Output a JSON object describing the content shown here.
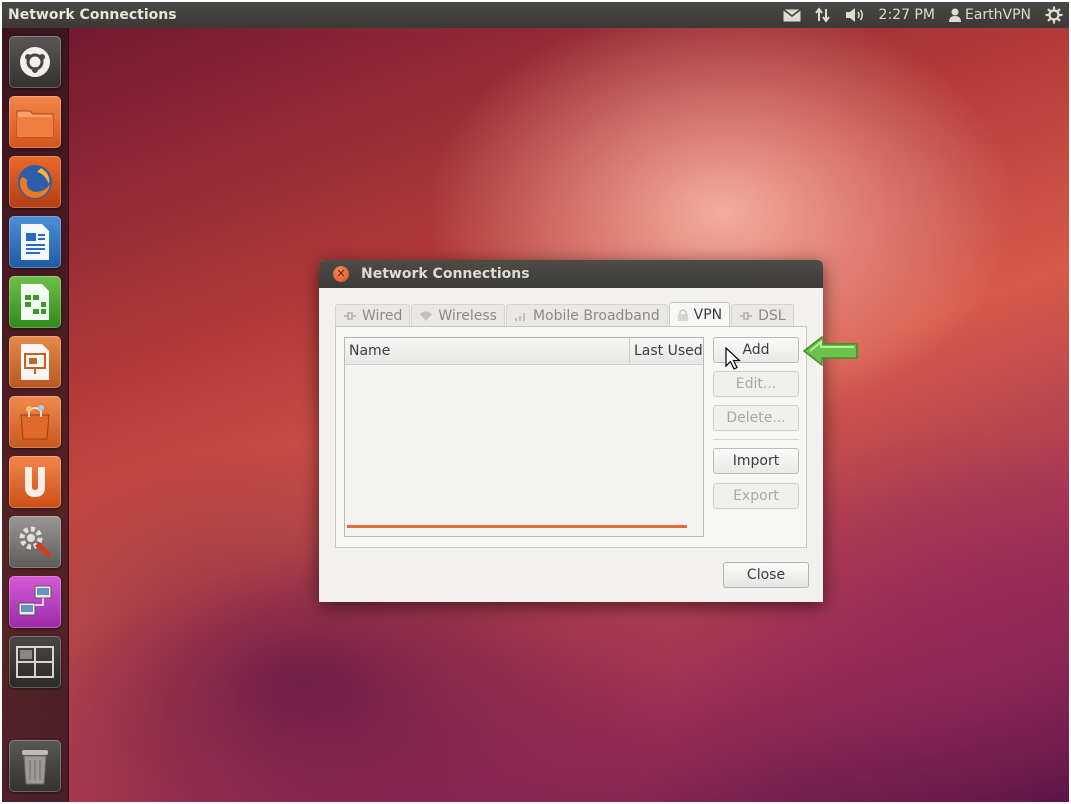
{
  "top_panel": {
    "app_title": "Network Connections",
    "clock": "2:27 PM",
    "user": "EarthVPN"
  },
  "launcher": {
    "items": [
      {
        "name": "dash-home",
        "icon": "ubuntu-logo-icon"
      },
      {
        "name": "files",
        "icon": "folder-icon"
      },
      {
        "name": "firefox",
        "icon": "firefox-icon"
      },
      {
        "name": "writer",
        "icon": "libreoffice-writer-icon"
      },
      {
        "name": "calc",
        "icon": "libreoffice-calc-icon"
      },
      {
        "name": "impress",
        "icon": "libreoffice-impress-icon"
      },
      {
        "name": "software-center",
        "icon": "shopping-bag-icon"
      },
      {
        "name": "ubuntu-one",
        "icon": "ubuntu-one-icon"
      },
      {
        "name": "system-settings",
        "icon": "settings-tools-icon"
      },
      {
        "name": "network-connections",
        "icon": "network-icon"
      },
      {
        "name": "workspace-switcher",
        "icon": "workspaces-icon"
      },
      {
        "name": "trash",
        "icon": "trash-icon"
      }
    ]
  },
  "dialog": {
    "title": "Network Connections",
    "tabs": [
      {
        "label": "Wired",
        "active": false
      },
      {
        "label": "Wireless",
        "active": false
      },
      {
        "label": "Mobile Broadband",
        "active": false
      },
      {
        "label": "VPN",
        "active": true
      },
      {
        "label": "DSL",
        "active": false
      }
    ],
    "columns": [
      "Name",
      "Last Used"
    ],
    "buttons": {
      "add": "Add",
      "edit": "Edit...",
      "delete": "Delete...",
      "import": "Import",
      "export": "Export",
      "close": "Close"
    }
  },
  "colors": {
    "accent_orange": "#e86a36",
    "highlight_arrow": "#6cc24a"
  }
}
